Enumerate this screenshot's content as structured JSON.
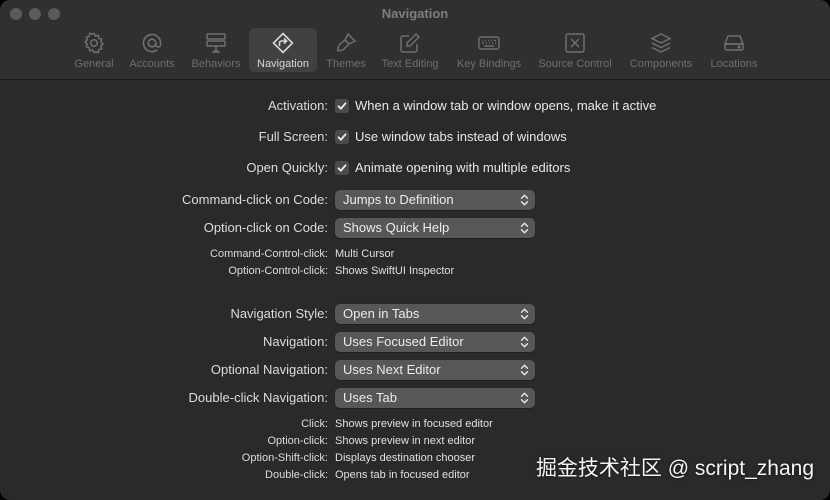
{
  "window": {
    "title": "Navigation"
  },
  "tabs": [
    {
      "label": "General",
      "icon": "gear-icon"
    },
    {
      "label": "Accounts",
      "icon": "at-sign-icon"
    },
    {
      "label": "Behaviors",
      "icon": "behaviors-icon"
    },
    {
      "label": "Navigation",
      "icon": "navigation-icon",
      "active": true
    },
    {
      "label": "Themes",
      "icon": "brush-icon"
    },
    {
      "label": "Text Editing",
      "icon": "pencil-square-icon"
    },
    {
      "label": "Key Bindings",
      "icon": "keyboard-icon"
    },
    {
      "label": "Source Control",
      "icon": "source-control-icon"
    },
    {
      "label": "Components",
      "icon": "layers-icon"
    },
    {
      "label": "Locations",
      "icon": "drive-icon"
    }
  ],
  "settings": {
    "activation": {
      "label": "Activation:",
      "text": "When a window tab or window opens, make it active",
      "checked": true
    },
    "full_screen": {
      "label": "Full Screen:",
      "text": "Use window tabs instead of windows",
      "checked": true
    },
    "open_quickly": {
      "label": "Open Quickly:",
      "text": "Animate opening with multiple editors",
      "checked": true
    },
    "command_click": {
      "label": "Command-click on Code:",
      "value": "Jumps to Definition"
    },
    "option_click": {
      "label": "Option-click on Code:",
      "value": "Shows Quick Help"
    },
    "command_control_click": {
      "label": "Command-Control-click:",
      "value": "Multi Cursor"
    },
    "option_control_click": {
      "label": "Option-Control-click:",
      "value": "Shows SwiftUI Inspector"
    },
    "navigation_style": {
      "label": "Navigation Style:",
      "value": "Open in Tabs"
    },
    "navigation": {
      "label": "Navigation:",
      "value": "Uses Focused Editor"
    },
    "optional_navigation": {
      "label": "Optional Navigation:",
      "value": "Uses Next Editor"
    },
    "double_click_navigation": {
      "label": "Double-click Navigation:",
      "value": "Uses Tab"
    },
    "click": {
      "label": "Click:",
      "value": "Shows preview in focused editor"
    },
    "option_click_info": {
      "label": "Option-click:",
      "value": "Shows preview in next editor"
    },
    "option_shift_click": {
      "label": "Option-Shift-click:",
      "value": "Displays destination chooser"
    },
    "double_click": {
      "label": "Double-click:",
      "value": "Opens tab in focused editor"
    }
  },
  "watermark": "掘金技术社区 @ script_zhang"
}
